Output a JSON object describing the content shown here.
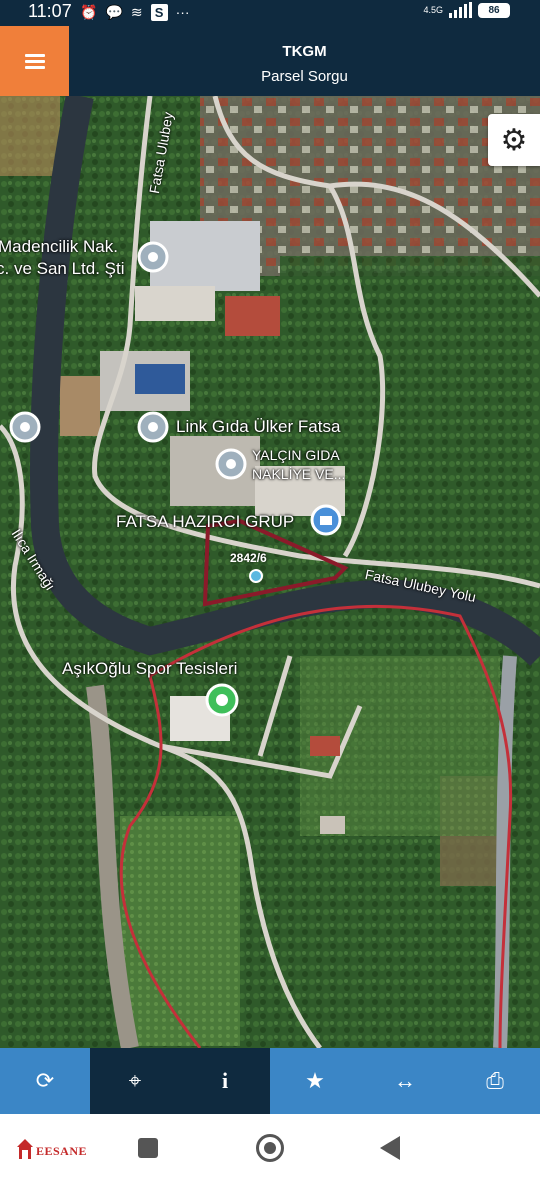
{
  "status_bar": {
    "time": "11:07",
    "network": "4.5G",
    "battery": "86"
  },
  "header": {
    "title": "TKGM",
    "subtitle": "Parsel Sorgu"
  },
  "map": {
    "parcel_label": "2842/6",
    "labels": {
      "madencilik_1": "Madencilik Nak.",
      "madencilik_2": "c. ve San Ltd. Şti",
      "link": "Link Gıda Ülker Fatsa",
      "yalcin_1": "YALÇIN GIDA",
      "yalcin_2": "NAKLİYE VE...",
      "hazirci": "FATSA HAZIRCI GRUP",
      "yolu": "Fatsa Ulubey Yolu",
      "irmak": "Ilıca Irmağı",
      "asikoglu": "AşıkOğlu Spor Tesisleri",
      "fatsa_ulubey": "Fatsa Ulubey"
    }
  },
  "toolbar": {
    "items": [
      "refresh",
      "locate",
      "info",
      "favorite",
      "measure",
      "print"
    ]
  },
  "brand": {
    "text": "EESANE"
  }
}
